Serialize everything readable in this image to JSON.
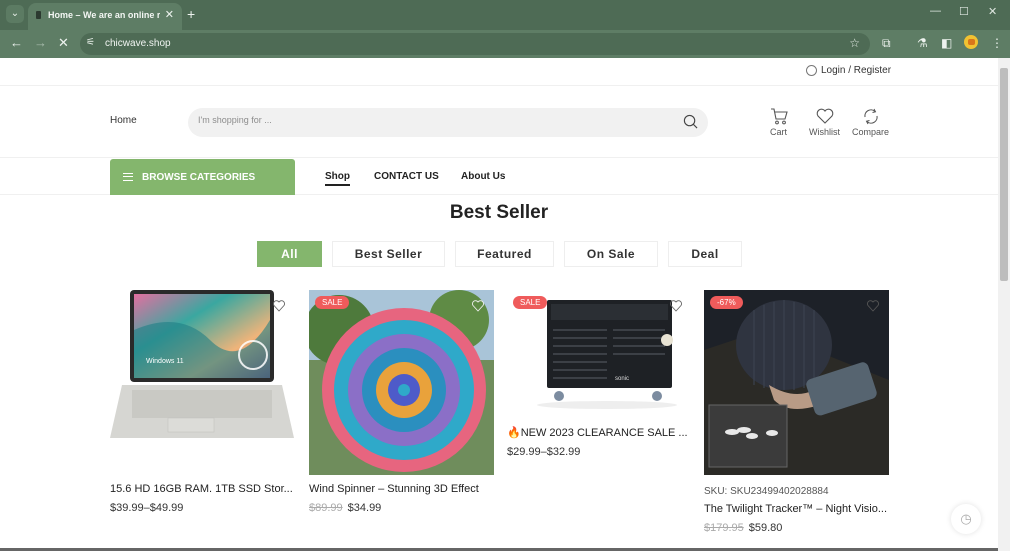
{
  "browser": {
    "tab_title": "Home – We are an online retailer",
    "url": "chicwave.shop",
    "new_tab": "+",
    "tab_close": "✕",
    "minimize": "—",
    "maximize": "☐",
    "close": "✕"
  },
  "topbar": {
    "login_label": "Login / Register"
  },
  "header": {
    "home_label": "Home",
    "search_placeholder": "I'm shopping for ...",
    "actions": [
      {
        "label": "Cart",
        "icon": "cart-icon"
      },
      {
        "label": "Wishlist",
        "icon": "heart-icon"
      },
      {
        "label": "Compare",
        "icon": "compare-icon"
      }
    ]
  },
  "nav": {
    "browse_label": "BROWSE CATEGORIES",
    "links": [
      {
        "label": "Shop",
        "active": true
      },
      {
        "label": "CONTACT US",
        "active": false
      },
      {
        "label": "About Us",
        "active": false
      }
    ]
  },
  "section": {
    "title": "Best Seller",
    "filters": [
      {
        "label": "All",
        "active": true
      },
      {
        "label": "Best Seller",
        "active": false
      },
      {
        "label": "Featured",
        "active": false
      },
      {
        "label": "On Sale",
        "active": false
      },
      {
        "label": "Deal",
        "active": false
      }
    ]
  },
  "products": [
    {
      "name": "15.6 HD 16GB RAM. 1TB SSD Stor...",
      "price": "$39.99–$49.99",
      "old_price": "",
      "badge": "",
      "sku": "",
      "image": "laptop"
    },
    {
      "name": "Wind Spinner – Stunning 3D Effect",
      "price": "$34.99",
      "old_price": "$89.99",
      "badge": "SALE",
      "sku": "",
      "image": "wind-spinner"
    },
    {
      "name": "🔥NEW 2023 CLEARANCE SALE ...",
      "price": "$29.99–$32.99",
      "old_price": "",
      "badge": "SALE",
      "sku": "",
      "image": "tool-chest"
    },
    {
      "name": "The Twilight Tracker™ – Night Visio...",
      "price": "$59.80",
      "old_price": "$179.95",
      "badge": "-67%",
      "sku": "SKU: SKU23499402028884",
      "image": "night-vision"
    }
  ],
  "colors": {
    "accent": "#84b66d",
    "badge": "#ef5b5b",
    "chrome": "#4e6b55"
  }
}
